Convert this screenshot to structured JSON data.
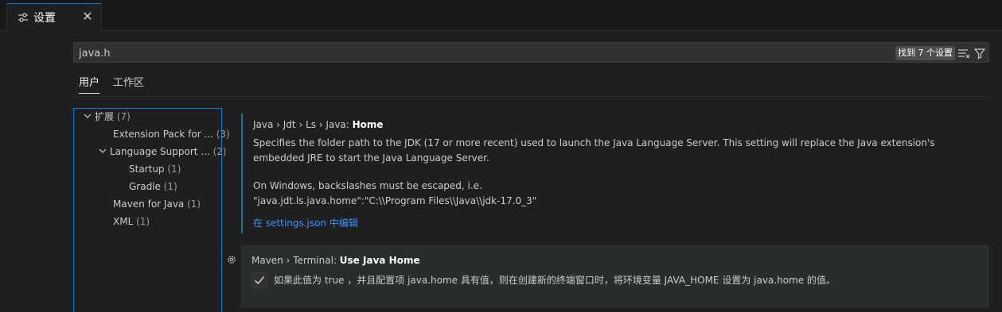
{
  "tab": {
    "icon": "settings-sliders-icon",
    "label": "设置",
    "close": "✕"
  },
  "search": {
    "value": "java.h",
    "result_count": "找到 7 个设置",
    "icons": [
      "clear-filter-lines-icon",
      "filter-icon"
    ]
  },
  "scopes": {
    "user": "用户",
    "workspace": "工作区"
  },
  "toc": {
    "items": [
      {
        "label": "扩展",
        "count": "(7)",
        "expanded": true
      },
      {
        "label": "Extension Pack for ...",
        "count": "(3)"
      },
      {
        "label": "Language Support ...",
        "count": "(2)",
        "expanded": true
      },
      {
        "label": "Startup",
        "count": "(1)"
      },
      {
        "label": "Gradle",
        "count": "(1)"
      },
      {
        "label": "Maven for Java",
        "count": "(1)"
      },
      {
        "label": "XML",
        "count": "(1)"
      }
    ]
  },
  "settings": [
    {
      "breadcrumb": "Java › Jdt › Ls › Java: ",
      "name": "Home",
      "description": "Specifies the folder path to the JDK (17 or more recent) used to launch the Java Language Server. This setting will replace the Java extension's embedded JRE to start the Java Language Server.",
      "note_line1": "On Windows, backslashes must be escaped, i.e.",
      "note_line2": "\"java.jdt.ls.java.home\":\"C:\\\\Program Files\\\\Java\\\\jdk-17.0_3\"",
      "link": "在 settings.json 中编辑"
    },
    {
      "breadcrumb": "Maven › Terminal: ",
      "name": "Use Java Home",
      "checked": true,
      "description": "如果此值为 true ，并且配置项 java.home 具有值，则在创建新的终端窗口时，将环境变量 JAVA_HOME 设置为 java.home 的值。",
      "gear_icon": "gear-icon"
    }
  ],
  "colors": {
    "accent": "#0078d4",
    "link": "#3794ff",
    "modified_indicator": "#0c7d9d"
  }
}
